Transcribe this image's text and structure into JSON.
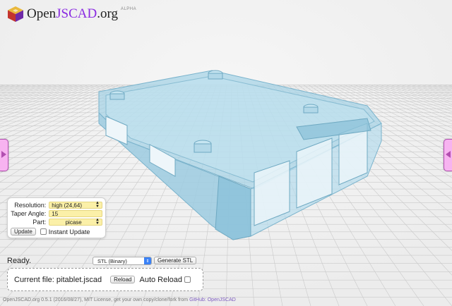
{
  "app": {
    "logo_name": "Open",
    "logo_highlight": "JSCAD",
    "logo_suffix": ".org",
    "logo_badge": "ALPHA"
  },
  "params": {
    "resolution_label": "Resolution:",
    "resolution_value": "high (24,64)",
    "taper_label": "Taper Angle:",
    "taper_value": "15",
    "part_label": "Part:",
    "part_value": "picase",
    "update_label": "Update",
    "instant_update_label": "Instant Update",
    "instant_update_checked": false
  },
  "status": {
    "text": "Ready.",
    "format_value": "STL (Binary)",
    "generate_label": "Generate STL"
  },
  "file": {
    "current_label": "Current file: pitablet.jscad",
    "reload_label": "Reload",
    "auto_reload_label": "Auto Reload",
    "auto_reload_checked": false
  },
  "footer": {
    "text": "OpenJSCAD.org 0.5.1 (2016/08/27), MIT License, get your own copy/clone/fork from ",
    "link_text": "GitHub: OpenJSCAD"
  },
  "colors": {
    "accent": "#8a2be2",
    "side_tab": "#f7b3f0",
    "param_field": "#fbf0a8",
    "model_fill": "#a7d3e6"
  }
}
